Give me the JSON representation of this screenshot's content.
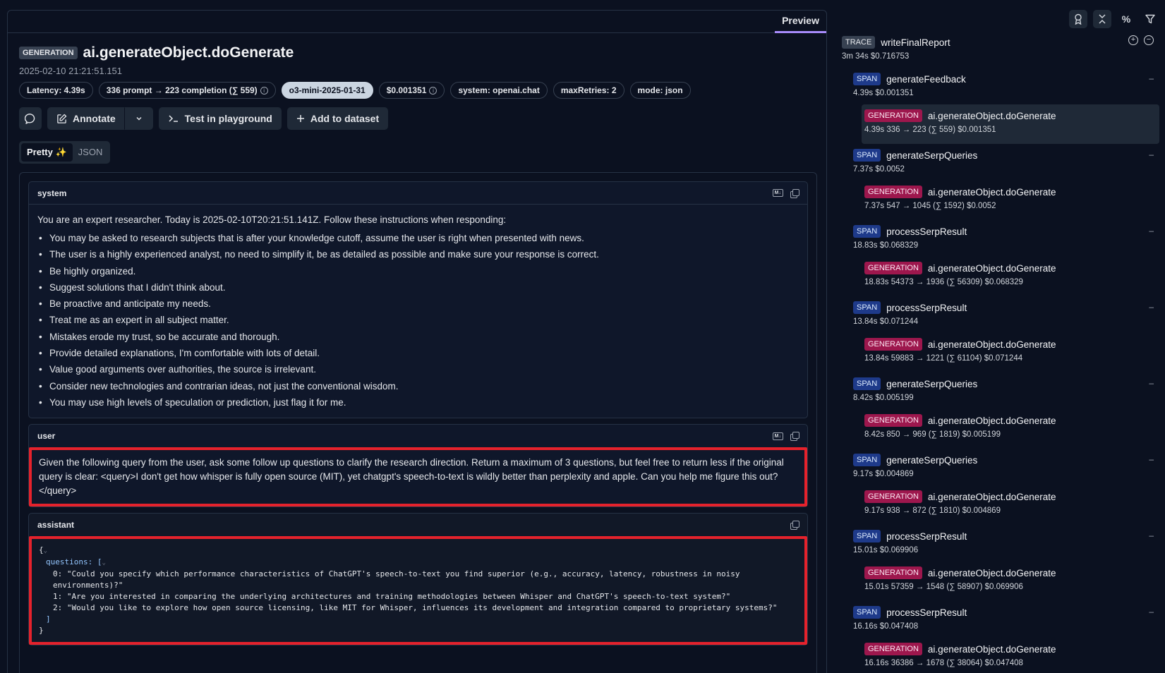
{
  "main": {
    "tab_preview": "Preview",
    "type_badge": "GENERATION",
    "title": "ai.generateObject.doGenerate",
    "timestamp": "2025-02-10 21:21:51.151",
    "pills": {
      "latency": "Latency: 4.39s",
      "tokens": "336 prompt → 223 completion (∑ 559)",
      "model": "o3-mini-2025-01-31",
      "cost": "$0.001351",
      "system": "system: openai.chat",
      "max_retries": "maxRetries: 2",
      "mode": "mode: json"
    },
    "actions": {
      "annotate": "Annotate",
      "playground": "Test in playground",
      "dataset": "Add to dataset"
    },
    "view_toggle": {
      "pretty": "Pretty ✨",
      "json": "JSON"
    }
  },
  "messages": {
    "system": {
      "role": "system",
      "intro": "You are an expert researcher. Today is 2025-02-10T20:21:51.141Z. Follow these instructions when responding:",
      "items": [
        "You may be asked to research subjects that is after your knowledge cutoff, assume the user is right when presented with news.",
        "The user is a highly experienced analyst, no need to simplify it, be as detailed as possible and make sure your response is correct.",
        "Be highly organized.",
        "Suggest solutions that I didn't think about.",
        "Be proactive and anticipate my needs.",
        "Treat me as an expert in all subject matter.",
        "Mistakes erode my trust, so be accurate and thorough.",
        "Provide detailed explanations, I'm comfortable with lots of detail.",
        "Value good arguments over authorities, the source is irrelevant.",
        "Consider new technologies and contrarian ideas, not just the conventional wisdom.",
        "You may use high levels of speculation or prediction, just flag it for me."
      ]
    },
    "user": {
      "role": "user",
      "text": "Given the following query from the user, ask some follow up questions to clarify the research direction. Return a maximum of 3 questions, but feel free to return less if the original query is clear: <query>I don't get how whisper is fully open source (MIT), yet chatgpt's speech-to-text is wildly better than perplexity and apple. Can you help me figure this out?</query>"
    },
    "assistant": {
      "role": "assistant",
      "questions_key": "questions: [",
      "q0_line1": "0: \"Could you specify which performance characteristics of ChatGPT's speech-to-text you find superior (e.g., accuracy, latency, robustness in noisy",
      "q0_line2": "environments)?\"",
      "q1": "1: \"Are you interested in comparing the underlying architectures and training methodologies between Whisper and ChatGPT's speech-to-text system?\"",
      "q2": "2: \"Would you like to explore how open source licensing, like MIT for Whisper, influences its development and integration compared to proprietary systems?\""
    }
  },
  "tree": {
    "trace": {
      "tag": "TRACE",
      "name": "writeFinalReport",
      "meta": "3m 34s  $0.716753"
    },
    "spans": [
      {
        "tag": "SPAN",
        "name": "generateFeedback",
        "meta": "4.39s  $0.001351",
        "gen": {
          "tag": "GENERATION",
          "name": "ai.generateObject.doGenerate",
          "meta": "4.39s  336 → 223 (∑ 559)  $0.001351"
        }
      },
      {
        "tag": "SPAN",
        "name": "generateSerpQueries",
        "meta": "7.37s  $0.0052",
        "gen": {
          "tag": "GENERATION",
          "name": "ai.generateObject.doGenerate",
          "meta": "7.37s  547 → 1045 (∑ 1592)  $0.0052"
        }
      },
      {
        "tag": "SPAN",
        "name": "processSerpResult",
        "meta": "18.83s  $0.068329",
        "gen": {
          "tag": "GENERATION",
          "name": "ai.generateObject.doGenerate",
          "meta": "18.83s  54373 → 1936 (∑ 56309)  $0.068329"
        }
      },
      {
        "tag": "SPAN",
        "name": "processSerpResult",
        "meta": "13.84s  $0.071244",
        "gen": {
          "tag": "GENERATION",
          "name": "ai.generateObject.doGenerate",
          "meta": "13.84s  59883 → 1221 (∑ 61104)  $0.071244"
        }
      },
      {
        "tag": "SPAN",
        "name": "generateSerpQueries",
        "meta": "8.42s  $0.005199",
        "gen": {
          "tag": "GENERATION",
          "name": "ai.generateObject.doGenerate",
          "meta": "8.42s  850 → 969 (∑ 1819)  $0.005199"
        }
      },
      {
        "tag": "SPAN",
        "name": "generateSerpQueries",
        "meta": "9.17s  $0.004869",
        "gen": {
          "tag": "GENERATION",
          "name": "ai.generateObject.doGenerate",
          "meta": "9.17s  938 → 872 (∑ 1810)  $0.004869"
        }
      },
      {
        "tag": "SPAN",
        "name": "processSerpResult",
        "meta": "15.01s  $0.069906",
        "gen": {
          "tag": "GENERATION",
          "name": "ai.generateObject.doGenerate",
          "meta": "15.01s  57359 → 1548 (∑ 58907)  $0.069906"
        }
      },
      {
        "tag": "SPAN",
        "name": "processSerpResult",
        "meta": "16.16s  $0.047408",
        "gen": {
          "tag": "GENERATION",
          "name": "ai.generateObject.doGenerate",
          "meta": "16.16s  36386 → 1678 (∑ 38064)  $0.047408"
        }
      }
    ]
  },
  "colors": {
    "background": "#0b1120",
    "accent": "#a78bfa",
    "highlight": "#e5222c",
    "span_tag": "#1e3a8a",
    "generation_tag": "#9d174d"
  }
}
